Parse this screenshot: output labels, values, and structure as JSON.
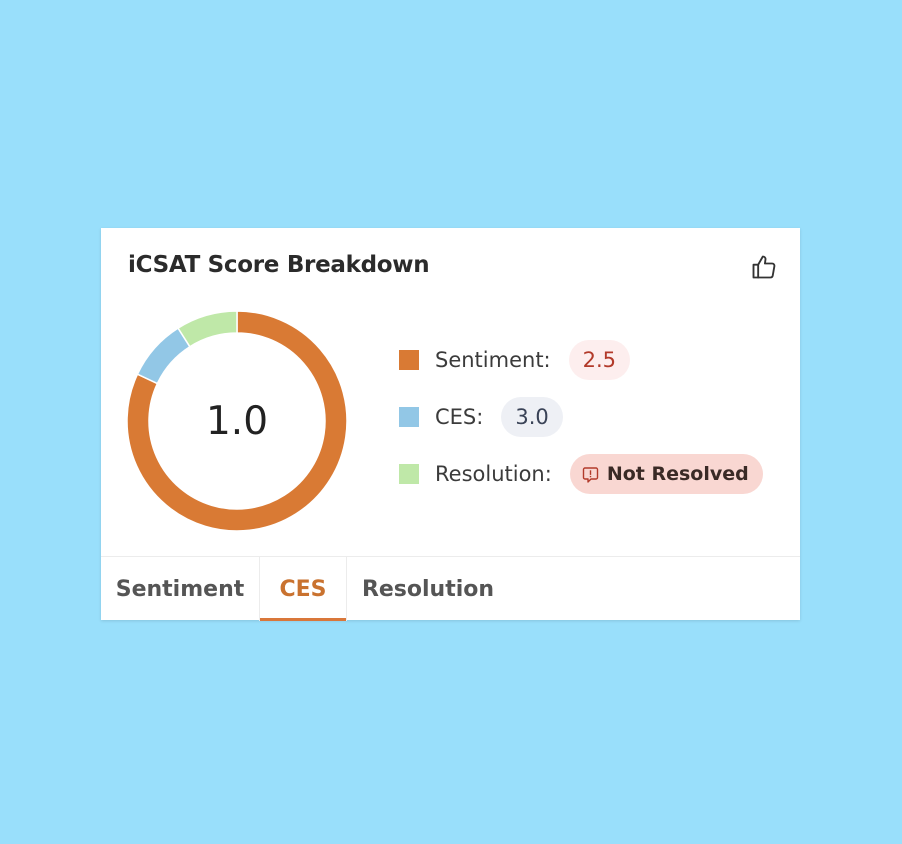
{
  "card": {
    "title": "iCSAT Score Breakdown",
    "icon": "thumbs-up-icon",
    "score": "1.0"
  },
  "donut": {
    "segments": [
      {
        "name": "Sentiment",
        "fraction": 0.82,
        "color": "#d97a34"
      },
      {
        "name": "CES",
        "fraction": 0.09,
        "color": "#92c7e6"
      },
      {
        "name": "Resolution",
        "fraction": 0.09,
        "color": "#bfe8a8"
      }
    ]
  },
  "legend": [
    {
      "label": "Sentiment:",
      "value": "2.5",
      "color": "#d97a34"
    },
    {
      "label": "CES:",
      "value": "3.0",
      "color": "#92c7e6"
    },
    {
      "label": "Resolution:",
      "value": "Not Resolved",
      "color": "#bfe8a8",
      "icon": "alert-icon"
    }
  ],
  "tabs": [
    {
      "label": "Sentiment",
      "active": false
    },
    {
      "label": "CES",
      "active": true
    },
    {
      "label": "Resolution",
      "active": false
    }
  ],
  "colors": {
    "background": "#99dffb",
    "accent": "#d9773a"
  }
}
